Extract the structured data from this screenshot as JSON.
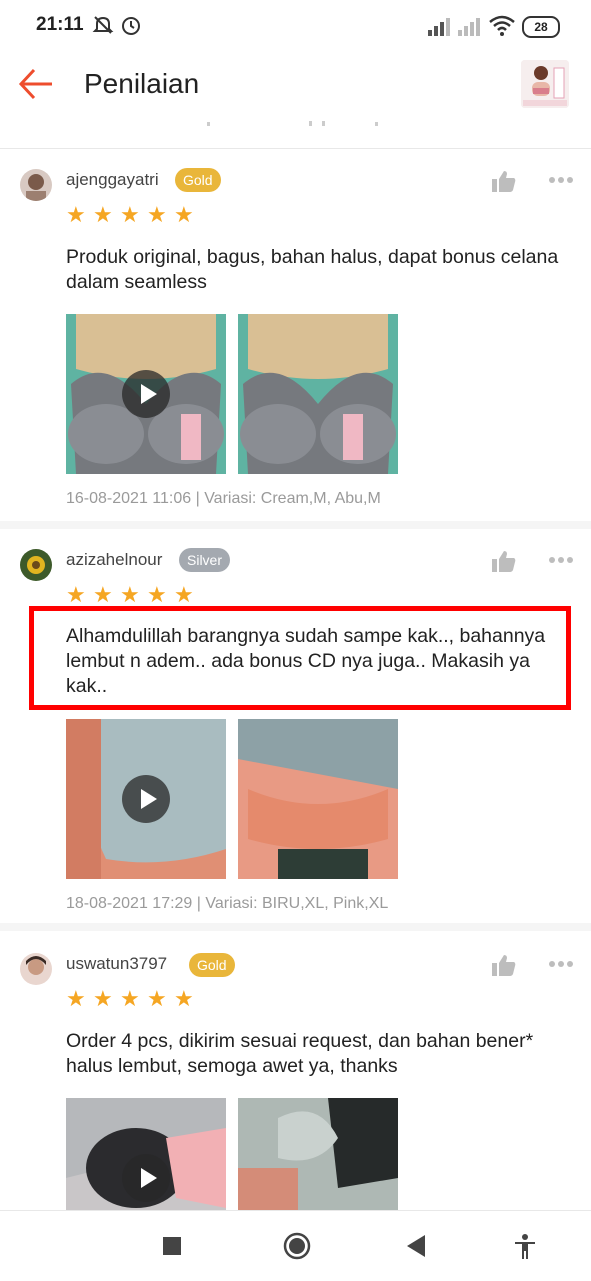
{
  "status_bar": {
    "time": "21:11",
    "battery": "28",
    "icons": [
      "mute-icon",
      "alarm-icon",
      "signal-icon",
      "signal-icon",
      "wifi-icon",
      "battery-icon"
    ]
  },
  "app_bar": {
    "title": "Penilaian",
    "back_icon": "back-arrow-icon",
    "accent": "#ee4d2d"
  },
  "reviews": [
    {
      "username": "ajenggayatri",
      "badge": "Gold",
      "rating": 5,
      "text": "Produk original, bagus, bahan halus, dapat bonus celana dalam seamless",
      "meta": "16-08-2021 11:06 | Variasi: Cream,M, Abu,M"
    },
    {
      "username": "azizahelnour",
      "badge": "Silver",
      "rating": 5,
      "text": "Alhamdulillah barangnya sudah sampe kak.., bahannya lembut n adem.. ada bonus CD nya juga.. Makasih ya kak..",
      "meta": "18-08-2021 17:29 | Variasi: BIRU,XL, Pink,XL"
    },
    {
      "username": "uswatun3797",
      "badge": "Gold",
      "rating": 5,
      "text": "Order 4 pcs, dikirim sesuai request, dan bahan bener* halus lembut, semoga awet ya, thanks",
      "meta": ""
    }
  ],
  "colors": {
    "star": "#f5a623",
    "gold_badge": "#e9b63a",
    "silver_badge": "#a4a9b0",
    "highlight_box": "#ff0000"
  }
}
